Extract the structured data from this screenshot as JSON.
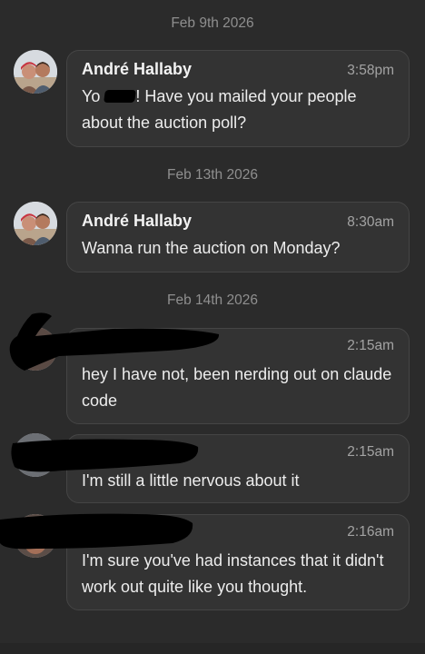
{
  "feed": {
    "dates": [
      "Feb 9th 2026",
      "Feb 13th 2026",
      "Feb 14th 2026"
    ],
    "messages": [
      {
        "sender": "André Hallaby",
        "time": "3:58pm",
        "text_before_redaction": "Yo ",
        "text_after_redaction": "! Have you mailed your people about the auction poll?"
      },
      {
        "sender": "André Hallaby",
        "time": "8:30am",
        "text": "Wanna run the auction on Monday?"
      },
      {
        "time": "2:15am",
        "text": "hey I have not, been nerding out on claude code"
      },
      {
        "time": "2:15am",
        "text": "I'm still a little nervous about it"
      },
      {
        "time": "2:16am",
        "text": "I'm sure you've had instances that it didn't work out quite like you thought."
      }
    ]
  },
  "colors": {
    "background": "#2b2b2b",
    "bubble": "#333333",
    "bubble_border": "#454545",
    "text": "#ededed",
    "muted": "#8f8f8f",
    "redaction": "#000000"
  }
}
